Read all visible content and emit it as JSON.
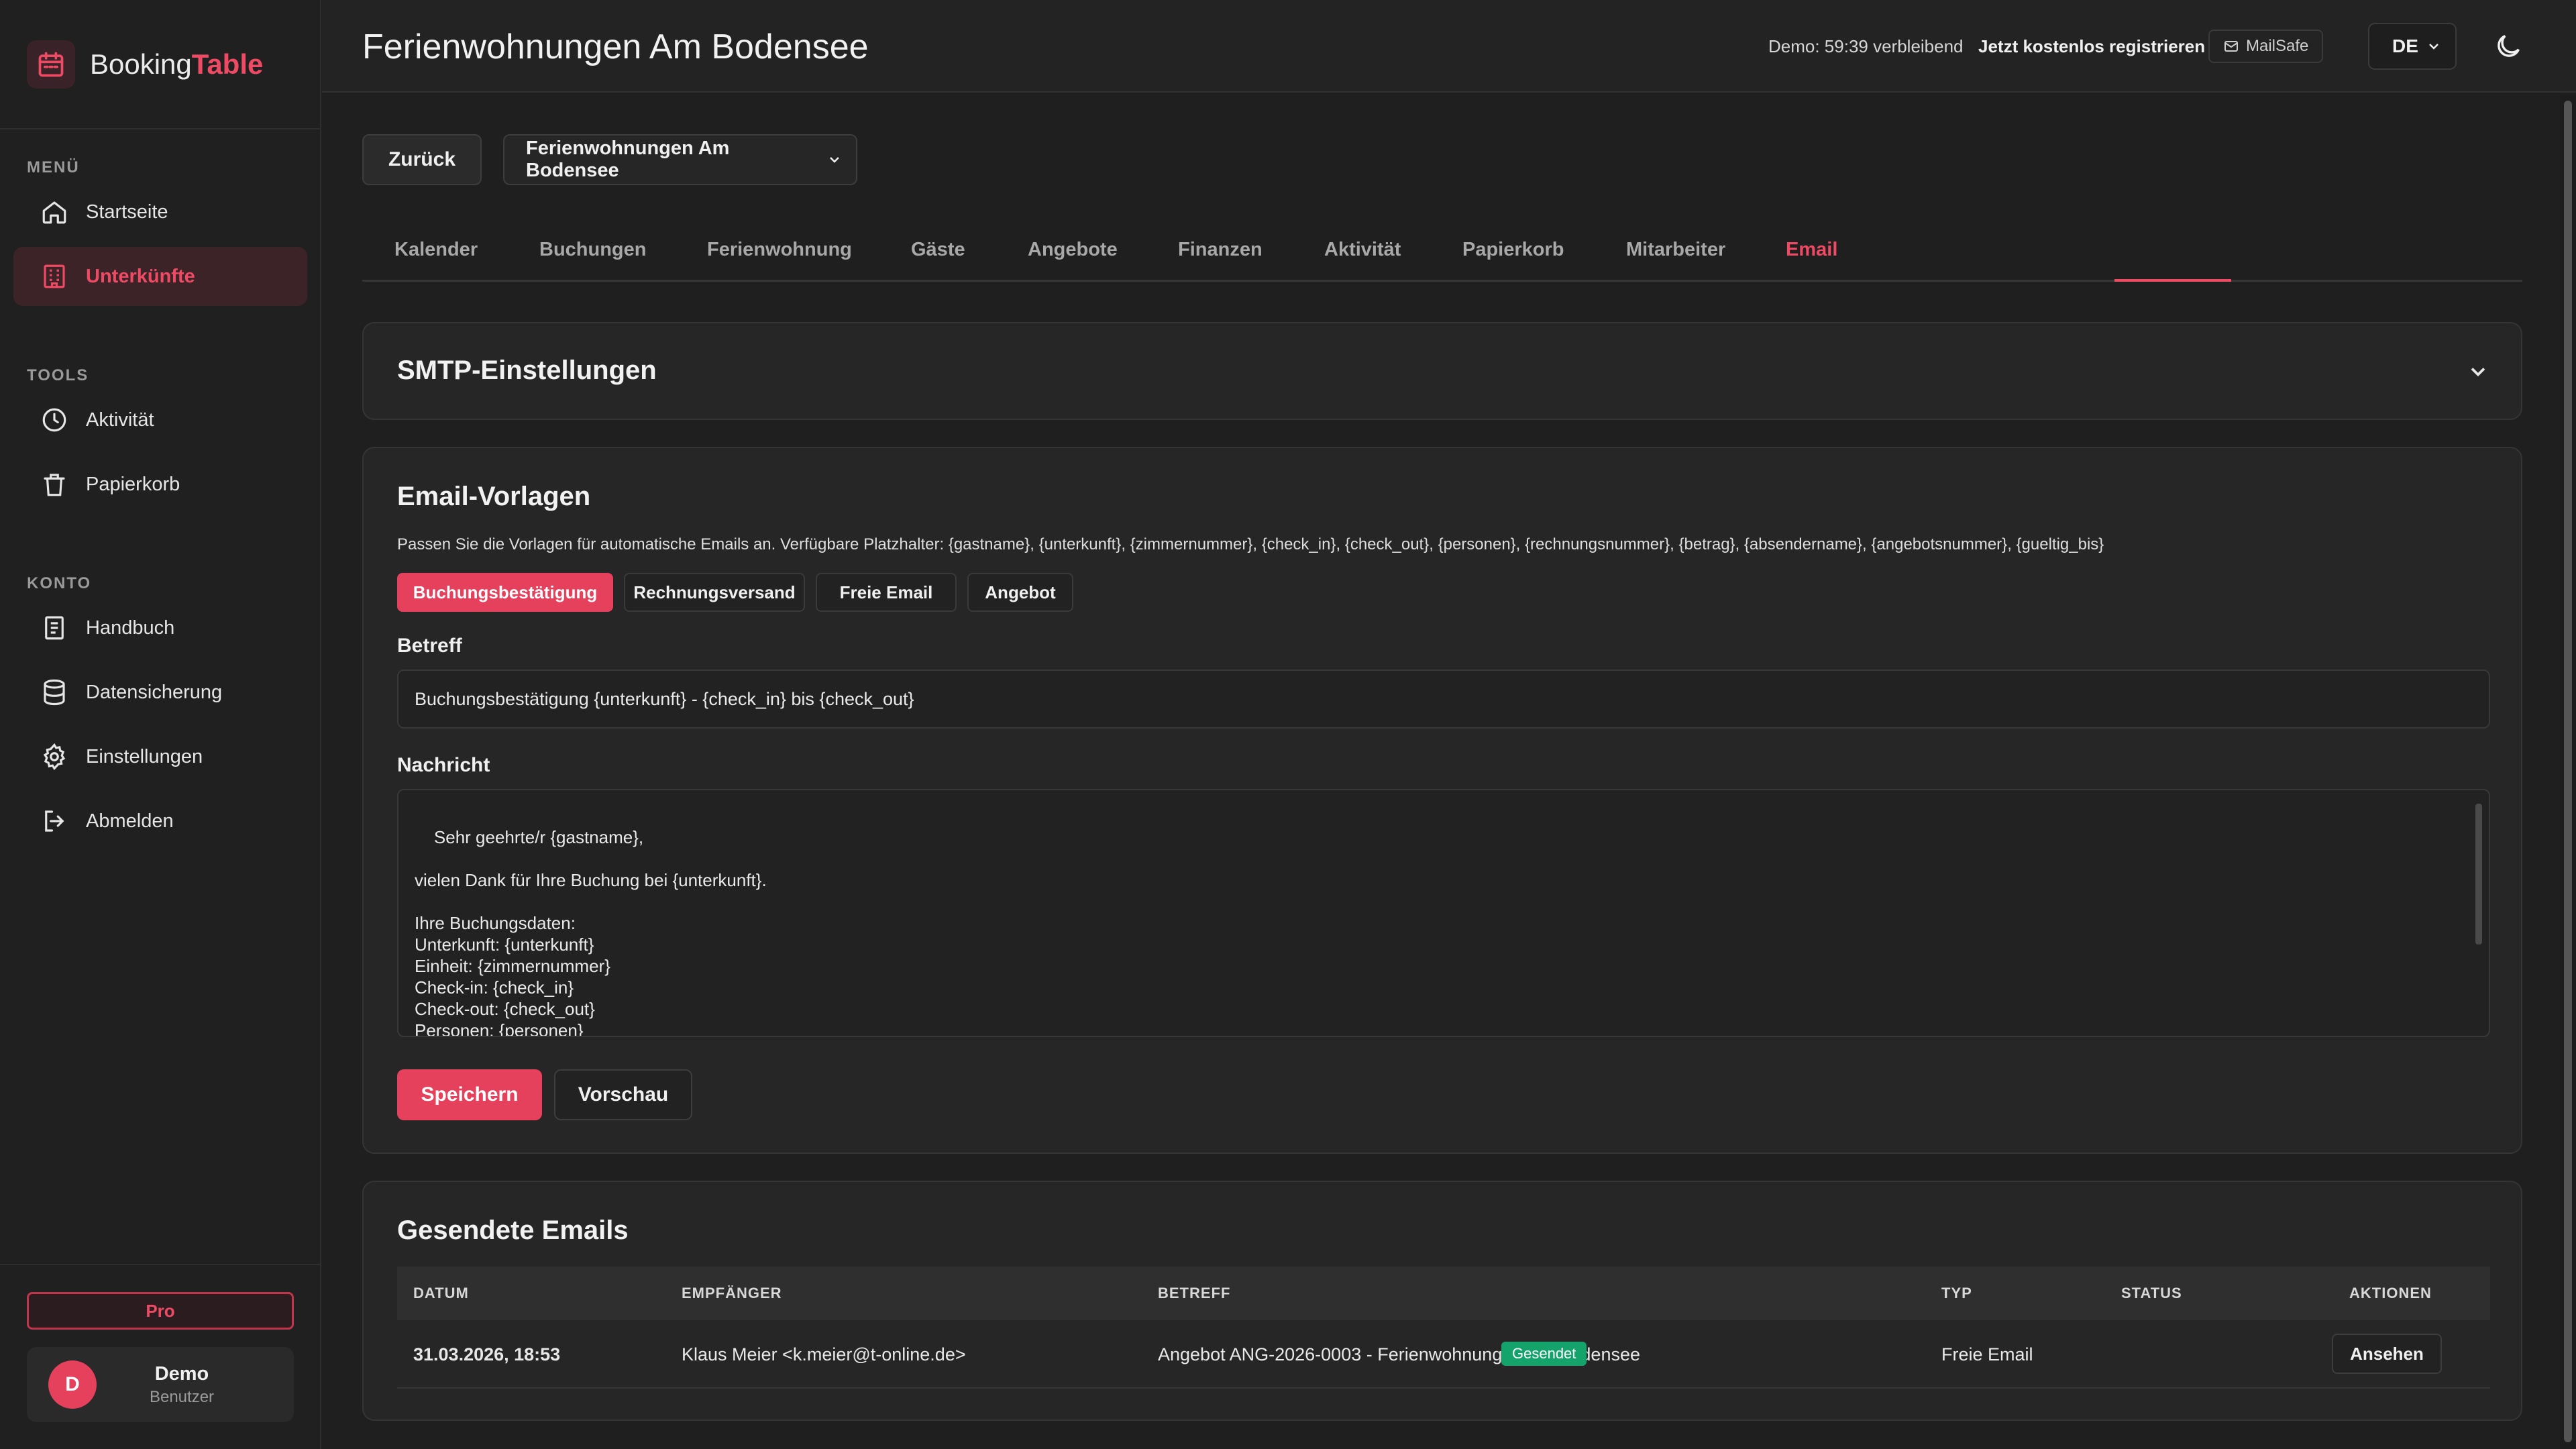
{
  "app": {
    "logo_text_1": "Booking",
    "logo_text_2": "Table",
    "accent_color": "#ef4a64"
  },
  "sidebar": {
    "sections": [
      {
        "label": "MENÜ",
        "items": [
          {
            "label": "Startseite",
            "icon": "home-icon"
          },
          {
            "label": "Unterkünfte",
            "icon": "building-icon",
            "active": true
          }
        ]
      },
      {
        "label": "TOOLS",
        "items": [
          {
            "label": "Aktivität",
            "icon": "clock-icon"
          },
          {
            "label": "Papierkorb",
            "icon": "trash-icon"
          }
        ]
      },
      {
        "label": "KONTO",
        "items": [
          {
            "label": "Handbuch",
            "icon": "book-icon"
          },
          {
            "label": "Datensicherung",
            "icon": "database-icon"
          },
          {
            "label": "Einstellungen",
            "icon": "gear-icon"
          },
          {
            "label": "Abmelden",
            "icon": "logout-icon"
          }
        ]
      }
    ],
    "pro_label": "Pro",
    "user": {
      "initial": "D",
      "name": "Demo",
      "role": "Benutzer"
    }
  },
  "header": {
    "title": "Ferienwohnungen Am Bodensee",
    "demo_timer": "Demo: 59:39 verbleibend",
    "register": "Jetzt kostenlos registrieren",
    "mailsafe": "MailSafe",
    "language": "DE"
  },
  "controls": {
    "back_label": "Zurück",
    "property_selected": "Ferienwohnungen Am Bodensee"
  },
  "tabs": [
    "Kalender",
    "Buchungen",
    "Ferienwohnung",
    "Gäste",
    "Angebote",
    "Finanzen",
    "Aktivität",
    "Papierkorb",
    "Mitarbeiter",
    "Email"
  ],
  "active_tab": "Email",
  "smtp": {
    "title": "SMTP-Einstellungen"
  },
  "templates": {
    "title": "Email-Vorlagen",
    "description": "Passen Sie die Vorlagen für automatische Emails an. Verfügbare Platzhalter: {gastname}, {unterkunft}, {zimmernummer}, {check_in}, {check_out}, {personen}, {rechnungsnummer}, {betrag}, {absendername}, {angebotsnummer}, {gueltig_bis}",
    "types": [
      "Buchungsbestätigung",
      "Rechnungsversand",
      "Freie Email",
      "Angebot"
    ],
    "active_type": "Buchungsbestätigung",
    "subject_label": "Betreff",
    "subject_value": "Buchungsbestätigung {unterkunft} - {check_in} bis {check_out}",
    "message_label": "Nachricht",
    "message_value": "Sehr geehrte/r {gastname},\n\nvielen Dank für Ihre Buchung bei {unterkunft}.\n\nIhre Buchungsdaten:\nUnterkunft: {unterkunft}\nEinheit: {zimmernummer}\nCheck-in: {check_in}\nCheck-out: {check_out}\nPersonen: {personen}",
    "save_label": "Speichern",
    "preview_label": "Vorschau"
  },
  "sent": {
    "title": "Gesendete Emails",
    "columns": [
      "DATUM",
      "EMPFÄNGER",
      "BETREFF",
      "TYP",
      "STATUS",
      "AKTIONEN"
    ],
    "rows": [
      {
        "date": "31.03.2026, 18:53",
        "recipient": "Klaus Meier <k.meier@t-online.de>",
        "subject": "Angebot ANG-2026-0003 - Ferienwohnungen Am Bodensee",
        "type": "Freie Email",
        "status": "Gesendet",
        "action": "Ansehen"
      }
    ]
  }
}
